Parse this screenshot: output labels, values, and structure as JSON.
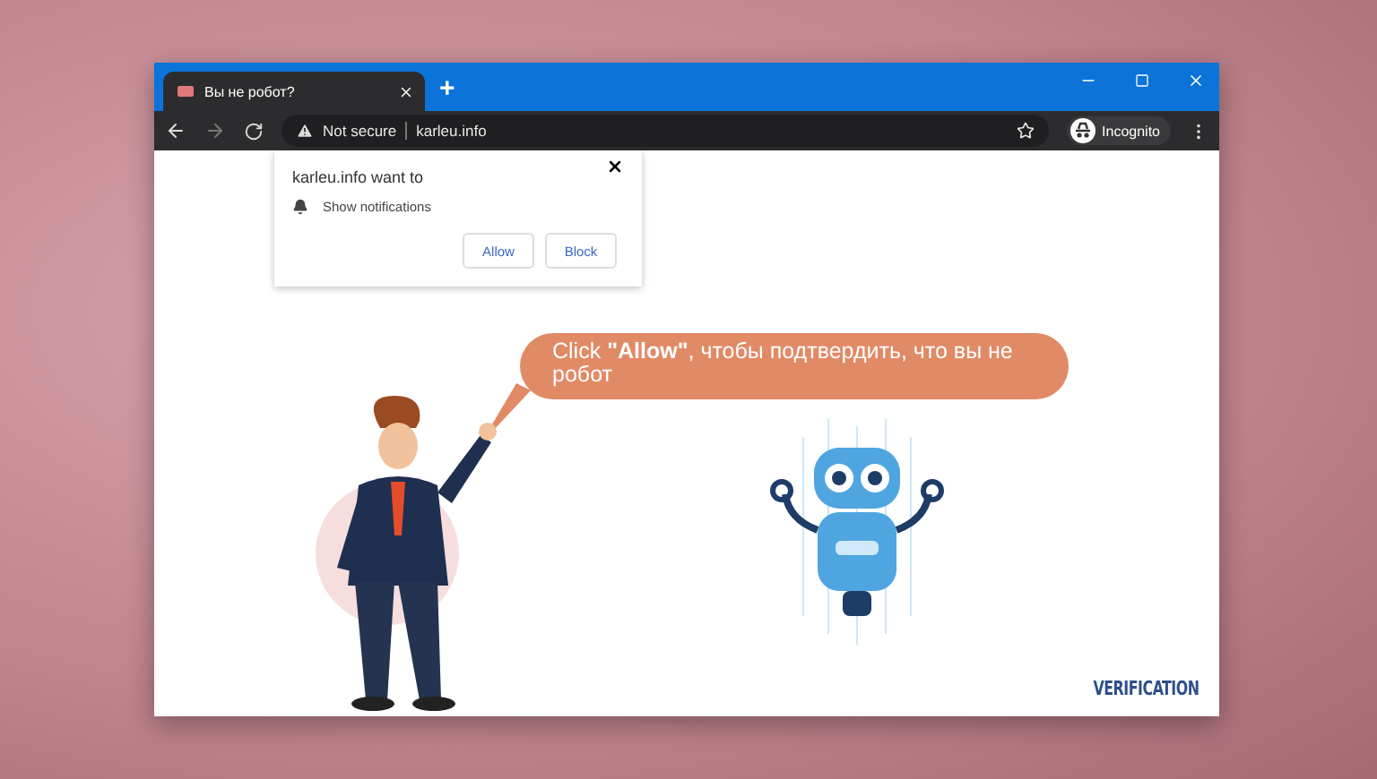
{
  "tabs": [
    {
      "title": "Вы не робот?",
      "selected": true
    }
  ],
  "new_tab": "+",
  "toolbar": {
    "security": "Not secure",
    "url": "karleu.info",
    "profile": "Incognito"
  },
  "popup": {
    "title": "karleu.info want to",
    "permission": "Show notifications",
    "buttons": [
      "Allow",
      "Block"
    ]
  },
  "bubble": {
    "text": "Click **\"Allow\"**, чтобы подтвердить, что вы не робот"
  },
  "footer": "VERIFICATION"
}
